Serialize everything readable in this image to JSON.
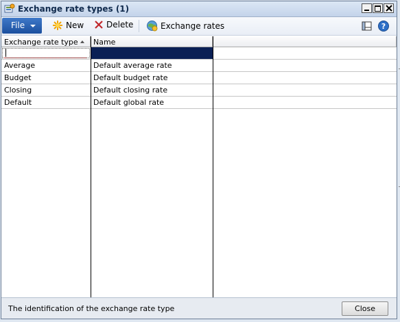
{
  "window": {
    "title": "Exchange rate types (1)"
  },
  "toolbar": {
    "file_label": "File",
    "new_label": "New",
    "delete_label": "Delete",
    "exchange_rates_label": "Exchange rates"
  },
  "grid": {
    "columns": [
      "Exchange rate type",
      "Name"
    ],
    "rows": [
      {
        "type": "Average",
        "name": "Default average rate"
      },
      {
        "type": "Budget",
        "name": "Default budget rate"
      },
      {
        "type": "Closing",
        "name": "Default closing rate"
      },
      {
        "type": "Default",
        "name": "Default global rate"
      }
    ]
  },
  "status": {
    "text": "The identification of the exchange rate type"
  },
  "footer": {
    "close_label": "Close"
  },
  "colors": {
    "selection": "#0b2055",
    "file_button": "#2a62b4"
  },
  "icons": [
    "app-icon",
    "new-icon",
    "delete-icon",
    "exchange-rates-icon",
    "layout-icon",
    "help-icon"
  ]
}
